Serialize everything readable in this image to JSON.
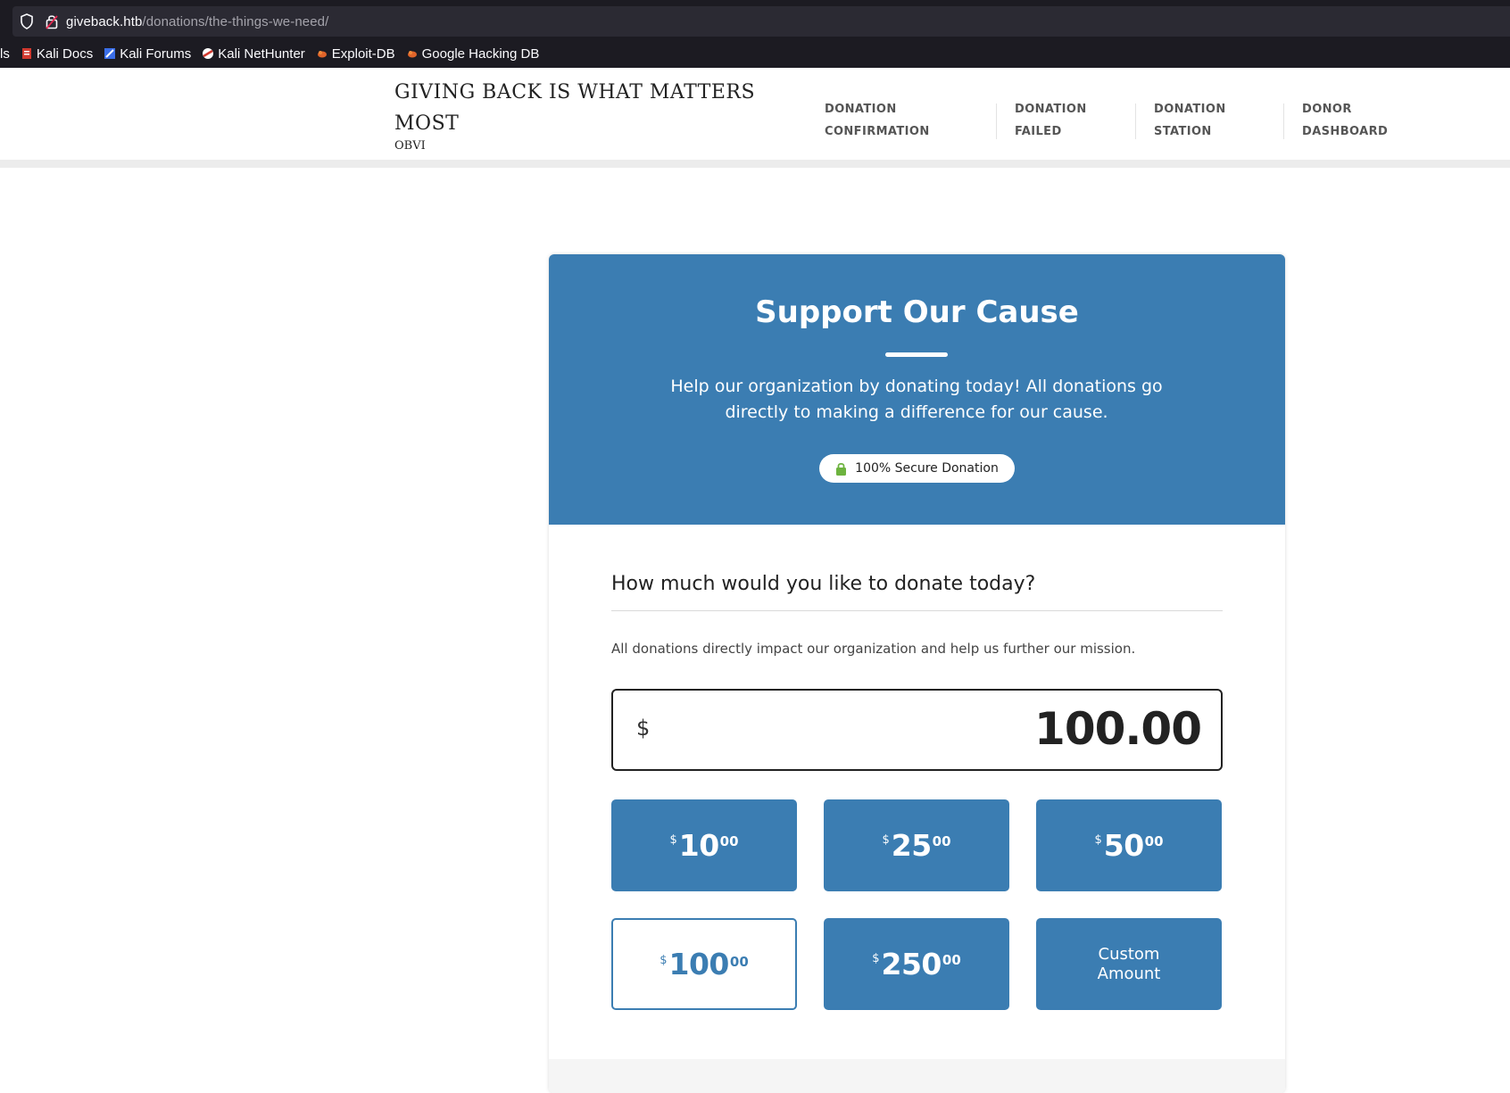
{
  "browser": {
    "url_host": "giveback.htb",
    "url_path": "/donations/the-things-we-need/",
    "bookmarks": [
      {
        "label": "ls",
        "icon": "cut-off-item"
      },
      {
        "label": "Kali Docs",
        "icon": "kali-docs-icon"
      },
      {
        "label": "Kali Forums",
        "icon": "kali-forums-icon"
      },
      {
        "label": "Kali NetHunter",
        "icon": "kali-nethunter-icon"
      },
      {
        "label": "Exploit-DB",
        "icon": "exploit-db-icon"
      },
      {
        "label": "Google Hacking DB",
        "icon": "ghdb-icon"
      }
    ]
  },
  "site": {
    "title": "GIVING BACK IS WHAT MATTERS MOST",
    "tagline": "OBVI",
    "nav": [
      {
        "label": "DONATION\nCONFIRMATION"
      },
      {
        "label": "DONATION\nFAILED"
      },
      {
        "label": "DONATION\nSTATION"
      },
      {
        "label": "DONOR\nDASHBOARD"
      }
    ]
  },
  "donation": {
    "hero_title": "Support Our Cause",
    "hero_text": "Help our organization by donating today! All donations go directly to making a difference for our cause.",
    "secure_label": "100% Secure Donation",
    "question": "How much would you like to donate today?",
    "impact_text": "All donations directly impact our organization and help us further our mission.",
    "currency_symbol": "$",
    "amount_value": "100.00",
    "amount_options": [
      {
        "symbol": "$",
        "whole": "10",
        "cents": "00",
        "selected": false
      },
      {
        "symbol": "$",
        "whole": "25",
        "cents": "00",
        "selected": false
      },
      {
        "symbol": "$",
        "whole": "50",
        "cents": "00",
        "selected": false
      },
      {
        "symbol": "$",
        "whole": "100",
        "cents": "00",
        "selected": true
      },
      {
        "symbol": "$",
        "whole": "250",
        "cents": "00",
        "selected": false
      }
    ],
    "custom_label": "Custom\nAmount"
  },
  "colors": {
    "accent": "#3b7db2",
    "secure_lock": "#6db33f"
  }
}
